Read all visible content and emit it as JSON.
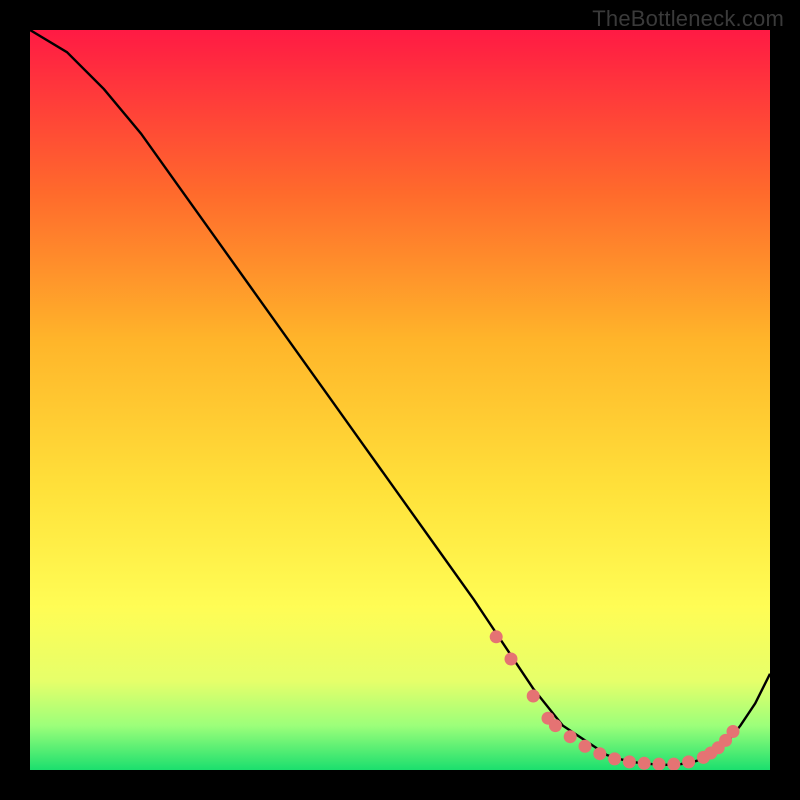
{
  "watermark": "TheBottleneck.com",
  "colors": {
    "gradient_top": "#ff1a44",
    "gradient_mid1": "#ff6a2c",
    "gradient_mid2": "#ffb52a",
    "gradient_mid3": "#ffe13a",
    "gradient_mid4": "#fffd55",
    "gradient_mid5": "#e6ff6a",
    "gradient_mid6": "#9cff7a",
    "gradient_bottom": "#1bdf6e",
    "line": "#000000",
    "marker": "#e57373"
  },
  "chart_data": {
    "type": "line",
    "title": "",
    "xlabel": "",
    "ylabel": "",
    "xlim": [
      0,
      100
    ],
    "ylim": [
      0,
      100
    ],
    "grid": false,
    "legend": false,
    "series": [
      {
        "name": "curve",
        "x": [
          0,
          5,
          10,
          15,
          20,
          25,
          30,
          35,
          40,
          45,
          50,
          55,
          60,
          62,
          66,
          68,
          72,
          75,
          78,
          80,
          82,
          84,
          86,
          88,
          90,
          92,
          94,
          96,
          98,
          100
        ],
        "y": [
          100,
          97,
          92,
          86,
          79,
          72,
          65,
          58,
          51,
          44,
          37,
          30,
          23,
          20,
          14,
          11,
          6,
          4,
          2,
          1.4,
          1.0,
          0.8,
          0.7,
          0.8,
          1.2,
          2.0,
          3.5,
          6.0,
          9.0,
          13
        ]
      }
    ],
    "markers": [
      {
        "x": 63,
        "y": 18
      },
      {
        "x": 65,
        "y": 15
      },
      {
        "x": 68,
        "y": 10
      },
      {
        "x": 70,
        "y": 7
      },
      {
        "x": 71,
        "y": 6
      },
      {
        "x": 73,
        "y": 4.5
      },
      {
        "x": 75,
        "y": 3.2
      },
      {
        "x": 77,
        "y": 2.2
      },
      {
        "x": 79,
        "y": 1.5
      },
      {
        "x": 81,
        "y": 1.1
      },
      {
        "x": 83,
        "y": 0.9
      },
      {
        "x": 85,
        "y": 0.8
      },
      {
        "x": 87,
        "y": 0.8
      },
      {
        "x": 89,
        "y": 1.1
      },
      {
        "x": 91,
        "y": 1.7
      },
      {
        "x": 92,
        "y": 2.3
      },
      {
        "x": 93,
        "y": 3.0
      },
      {
        "x": 94,
        "y": 4.0
      },
      {
        "x": 95,
        "y": 5.2
      }
    ]
  }
}
